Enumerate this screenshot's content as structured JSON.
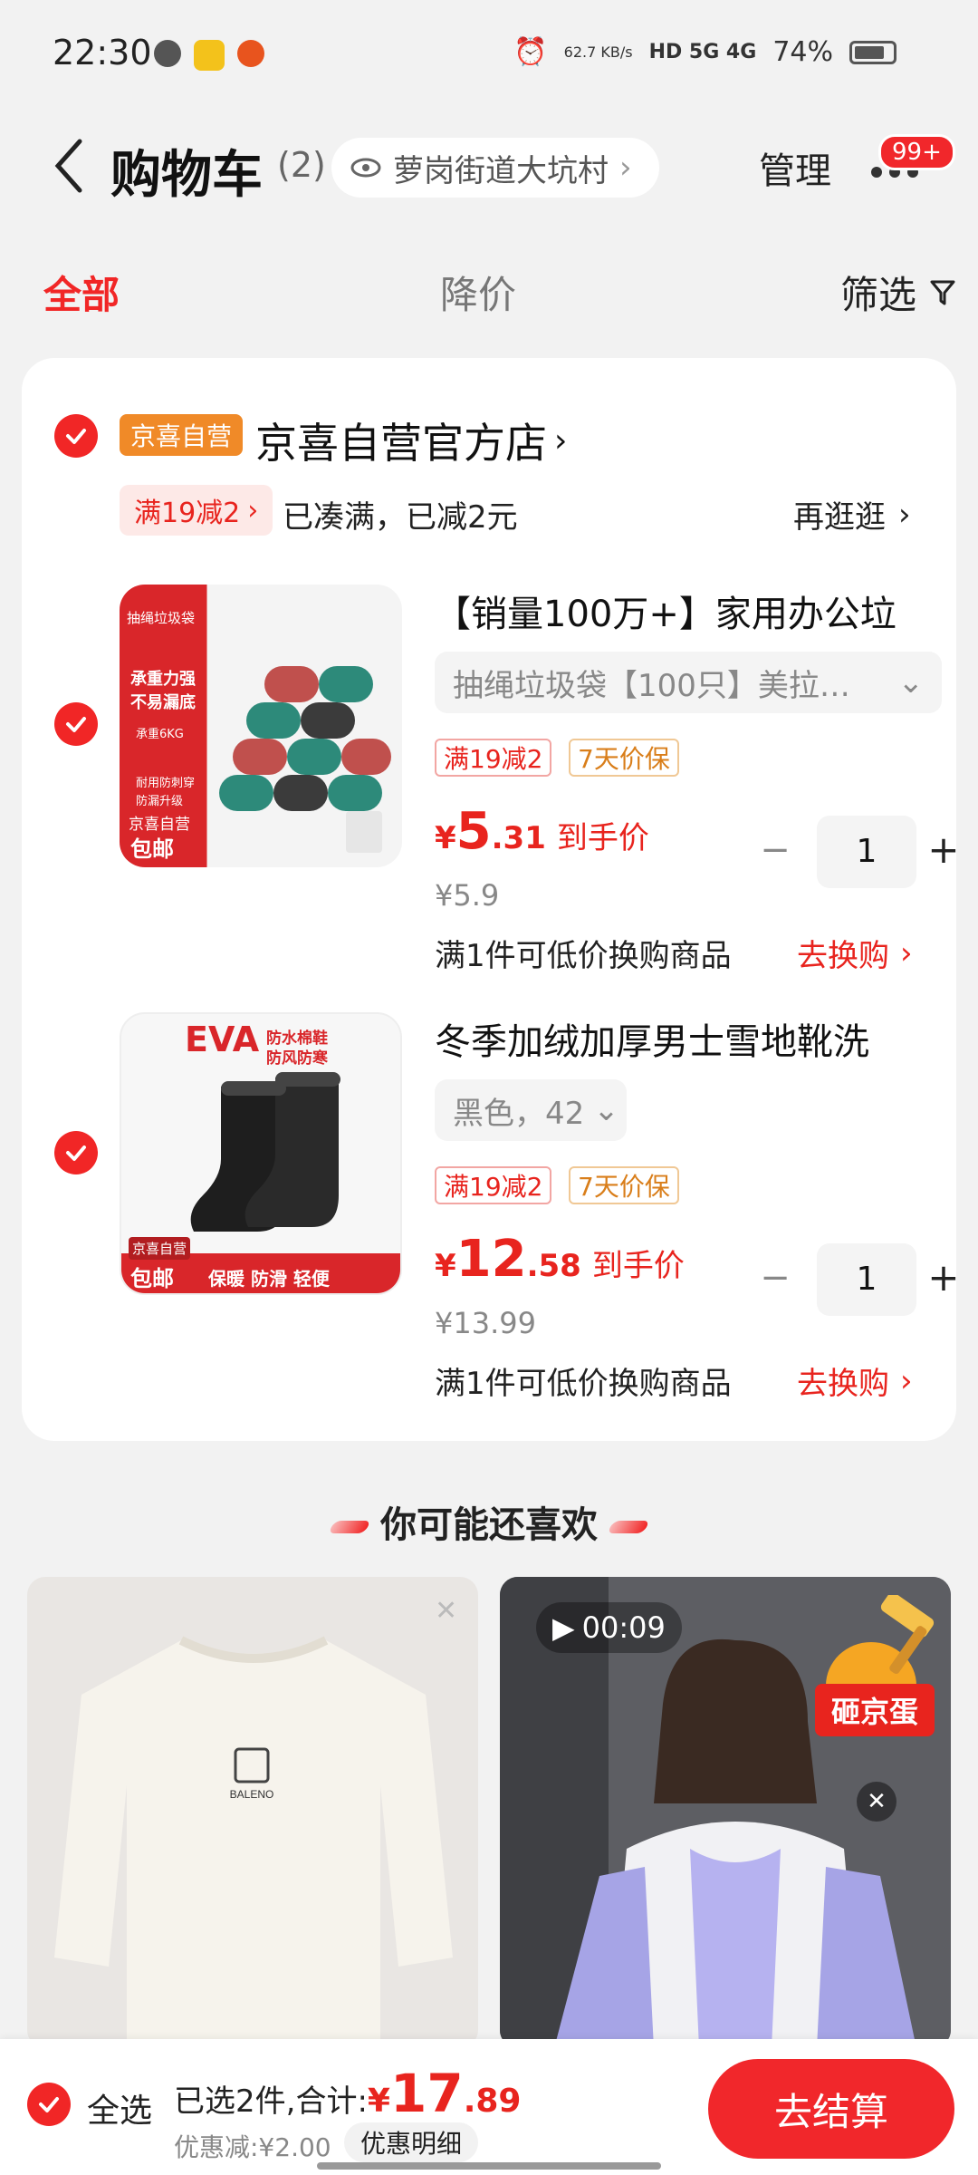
{
  "status_bar": {
    "time": "22:30",
    "speed": "62.7 KB/s",
    "network": "HD 5G 4G",
    "battery": "74%"
  },
  "header": {
    "title": "购物车",
    "count": "(2)",
    "location": "萝岗街道大坑村",
    "manage": "管理",
    "badge": "99+"
  },
  "tabs": {
    "all": "全部",
    "price_drop": "降价",
    "filter": "筛选"
  },
  "shop": {
    "tag": "京喜自营",
    "name": "京喜自营官方店",
    "promo_chip": "满19减2",
    "promo_text": "已凑满，已减2元",
    "browse_more": "再逛逛"
  },
  "items": [
    {
      "title": "【销量100万+】家用办公垃",
      "sku": "抽绳垃圾袋【100只】美拉…",
      "tag1": "满19减2",
      "tag2": "7天价保",
      "price_currency": "¥",
      "price_int": "5",
      "price_dec": ".31",
      "price_label": "到手价",
      "original_price": "¥5.9",
      "exchange_text": "满1件可低价换购商品",
      "exchange_link": "去换购",
      "quantity": "1",
      "img_header": "抽绳垃圾袋",
      "img_line1": "承重力强",
      "img_line2": "不易漏底",
      "img_line3": "承重6KG",
      "img_line4": "耐用防刺穿",
      "img_line5": "防漏升级",
      "img_badge1": "京喜自营",
      "img_badge2": "包邮"
    },
    {
      "title": "冬季加绒加厚男士雪地靴洗",
      "sku": "黑色，42",
      "tag1": "满19减2",
      "tag2": "7天价保",
      "price_currency": "¥",
      "price_int": "12",
      "price_dec": ".58",
      "price_label": "到手价",
      "original_price": "¥13.99",
      "exchange_text": "满1件可低价换购商品",
      "exchange_link": "去换购",
      "quantity": "1",
      "img_brand": "EVA",
      "img_sub1": "防水棉鞋",
      "img_sub2": "防风防寒",
      "img_footer": "保暖 防滑 轻便",
      "img_badge1": "京喜自营",
      "img_badge2": "包邮"
    }
  ],
  "recommendations": {
    "title": "你可能还喜欢",
    "video_time": "00:09",
    "egg_label": "砸京蛋",
    "sweater_logo": "BALENO"
  },
  "bottom_bar": {
    "select_all": "全选",
    "selected_prefix": "已选2件,合计:",
    "total_currency": "¥",
    "total_int": "17",
    "total_dec": ".89",
    "discount": "优惠减:¥2.00",
    "discount_detail": "优惠明细",
    "checkout": "去结算"
  },
  "colors": {
    "accent": "#f12626",
    "orange_tag": "#f08a28"
  }
}
